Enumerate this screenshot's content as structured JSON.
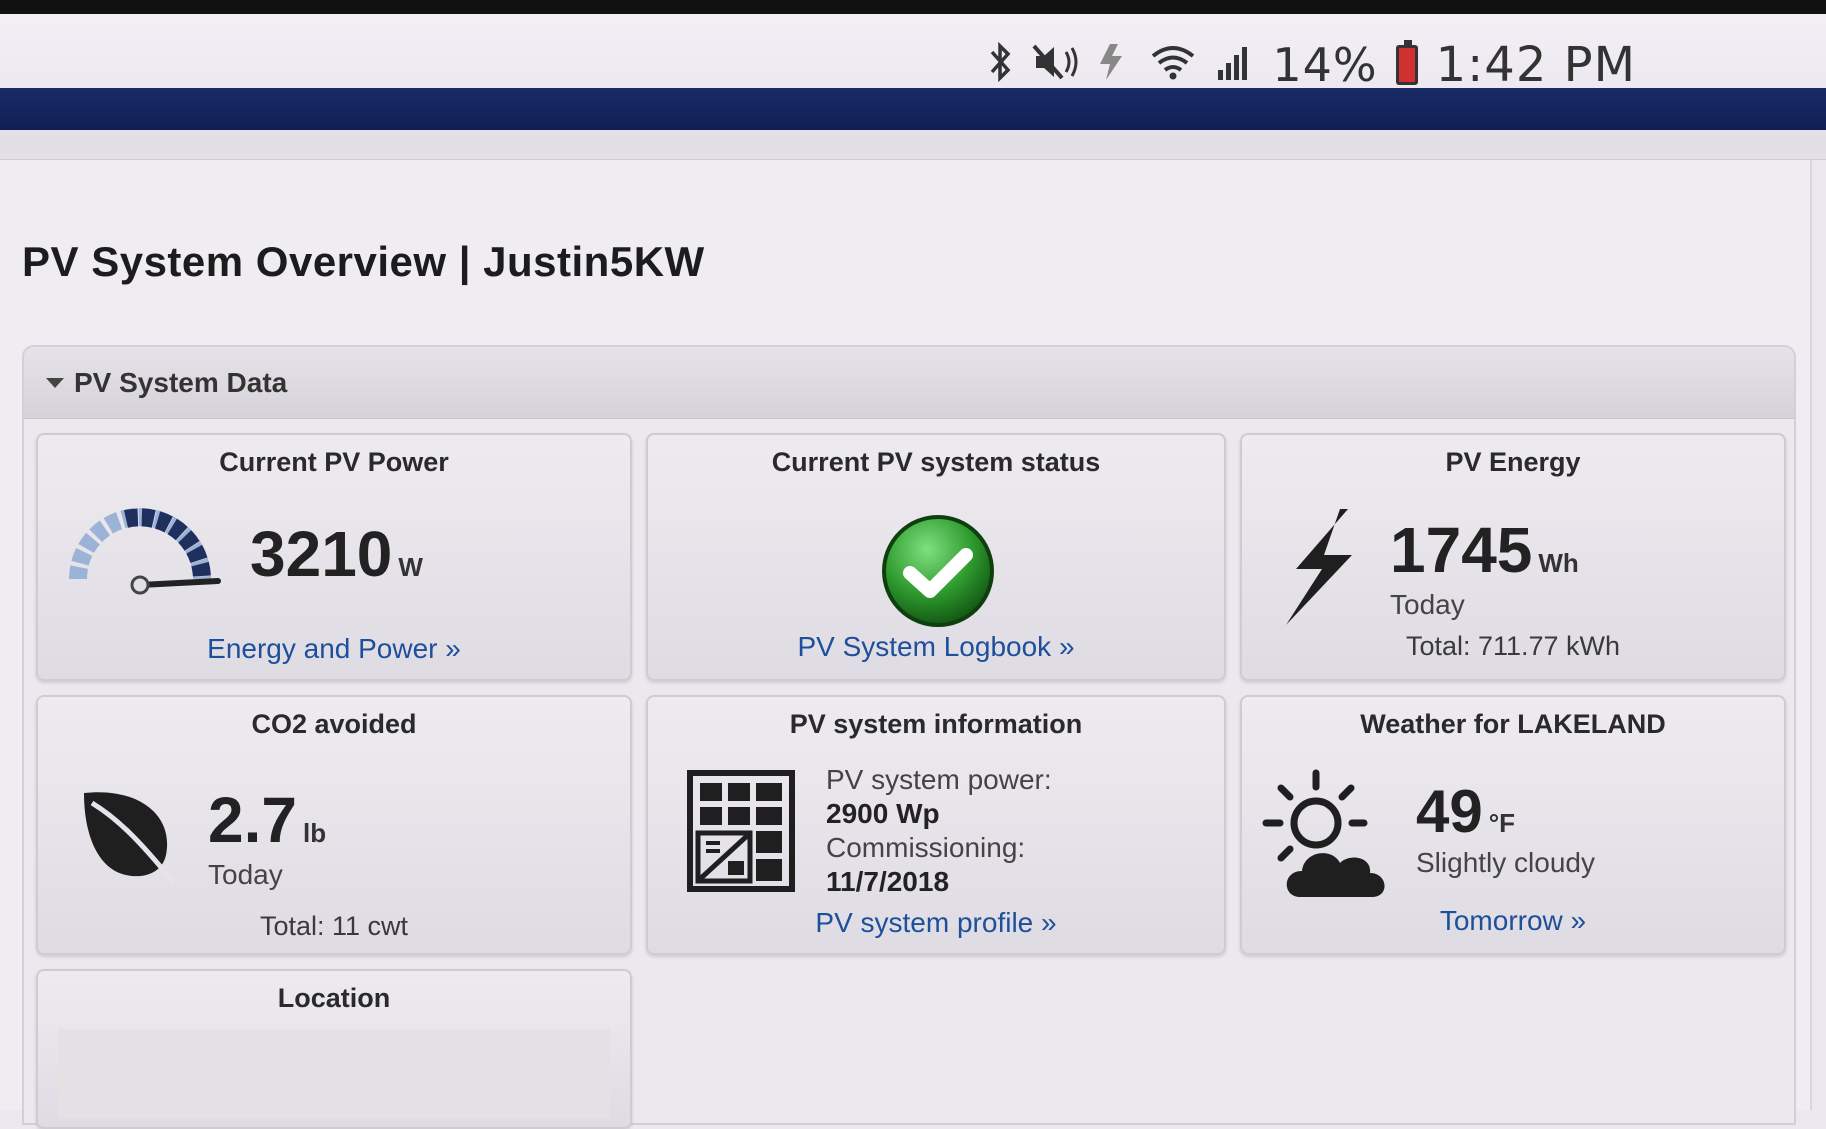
{
  "status_bar": {
    "battery_pct": "14%",
    "time": "1:42 PM",
    "icons": [
      "bluetooth-icon",
      "mute-icon",
      "flash-icon",
      "wifi-icon",
      "signal-icon",
      "battery-icon"
    ]
  },
  "page": {
    "title": "PV System Overview | Justin5KW"
  },
  "panel": {
    "title": "PV System Data"
  },
  "tiles": {
    "current_power": {
      "title": "Current PV Power",
      "value": "3210",
      "unit": "W",
      "link": "Energy and Power »"
    },
    "system_status": {
      "title": "Current PV system status",
      "status": "ok",
      "link": "PV System Logbook »"
    },
    "pv_energy": {
      "title": "PV Energy",
      "value": "1745",
      "unit": "Wh",
      "period": "Today",
      "total": "Total: 711.77 kWh"
    },
    "co2": {
      "title": "CO2 avoided",
      "value": "2.7",
      "unit": "lb",
      "period": "Today",
      "total": "Total: 11 cwt"
    },
    "system_info": {
      "title": "PV system information",
      "power_label": "PV system power:",
      "power_value": "2900 Wp",
      "commissioning_label": "Commissioning:",
      "commissioning_value": "11/7/2018",
      "link": "PV system profile »"
    },
    "weather": {
      "title": "Weather for LAKELAND",
      "temp": "49",
      "unit": "°F",
      "condition": "Slightly cloudy",
      "link": "Tomorrow »"
    },
    "location": {
      "title": "Location"
    }
  },
  "colors": {
    "nav_bar": "#102055",
    "link": "#1d4f9a",
    "status_ok": "#2e9a2e"
  }
}
